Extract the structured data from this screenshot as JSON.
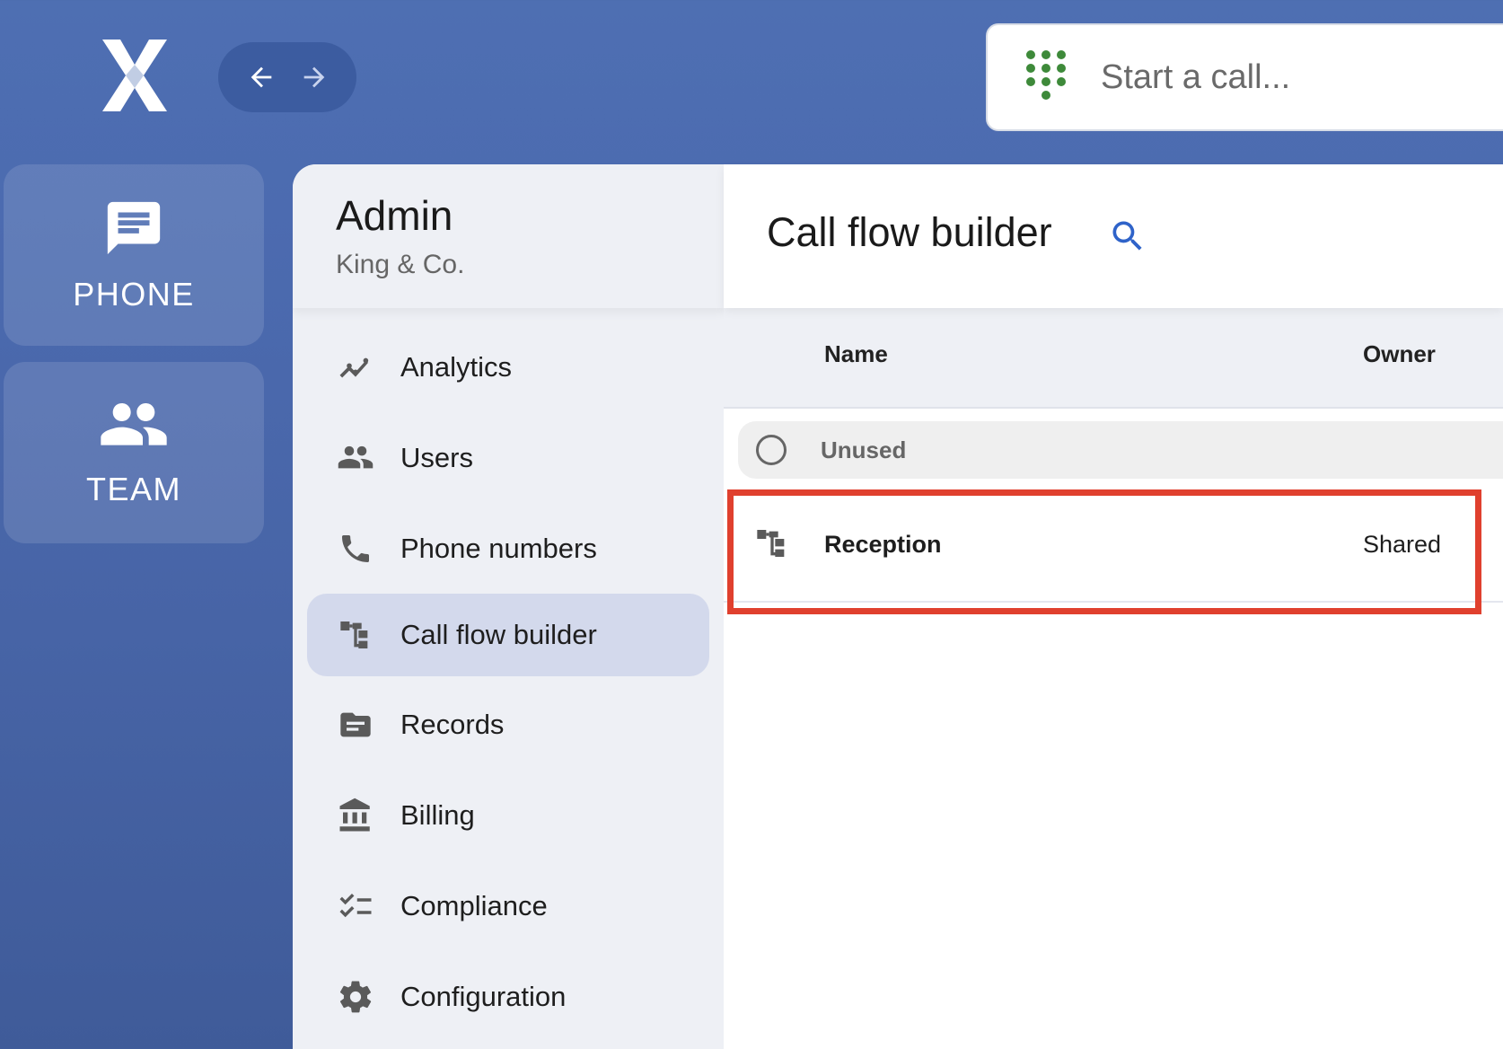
{
  "topbar": {
    "back_label": "Back",
    "forward_label": "Forward",
    "call_placeholder": "Start a call..."
  },
  "rail": {
    "phone_label": "PHONE",
    "team_label": "TEAM"
  },
  "admin": {
    "title": "Admin",
    "company": "King & Co.",
    "menu": [
      {
        "label": "Analytics",
        "icon": "analytics-icon"
      },
      {
        "label": "Users",
        "icon": "users-icon"
      },
      {
        "label": "Phone numbers",
        "icon": "phone-icon"
      },
      {
        "label": "Call flow builder",
        "icon": "call-flow-icon",
        "active": true
      },
      {
        "label": "Records",
        "icon": "folder-icon"
      },
      {
        "label": "Billing",
        "icon": "bank-icon"
      },
      {
        "label": "Compliance",
        "icon": "checklist-icon"
      },
      {
        "label": "Configuration",
        "icon": "gear-icon"
      }
    ]
  },
  "main": {
    "title": "Call flow builder",
    "columns": {
      "name": "Name",
      "owner": "Owner"
    },
    "unused_label": "Unused",
    "rows": [
      {
        "name": "Reception",
        "owner": "Shared"
      }
    ]
  },
  "colors": {
    "accent": "#2f63c9",
    "highlight": "#e0402e",
    "dialpad": "#3e8a3a"
  }
}
